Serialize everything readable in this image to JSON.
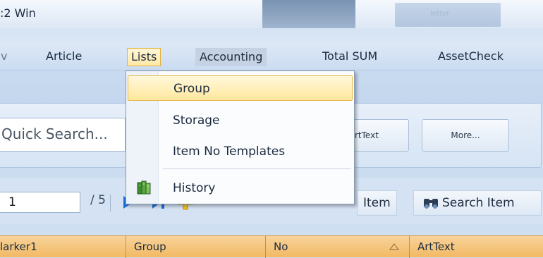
{
  "window": {
    "title": ":2 Win",
    "blurred_text": "letter"
  },
  "menu": {
    "items": [
      {
        "label": "Article"
      },
      {
        "label": "Lists"
      },
      {
        "label": "Accounting"
      },
      {
        "label": "Total SUM"
      },
      {
        "label": "AssetCheck"
      }
    ]
  },
  "dropdown": {
    "items": [
      {
        "label": "Group"
      },
      {
        "label": "Storage"
      },
      {
        "label": "Item No Templates"
      },
      {
        "label": "History",
        "icon": "history-books-icon"
      }
    ]
  },
  "search": {
    "quick_search_placeholder": "Quick Search...",
    "arttext_button": "rtText",
    "more_button": "More..."
  },
  "navigator": {
    "current_page": "1",
    "page_of": "/ 5",
    "item_button": "Item",
    "search_item_button": "Search Item"
  },
  "grid": {
    "columns": [
      "larker1",
      "Group",
      "No",
      "ArtText"
    ]
  },
  "colors": {
    "menu_highlight": "#ffe9a6",
    "header": "#f2b964",
    "accent_blue": "#1f6fd6"
  }
}
